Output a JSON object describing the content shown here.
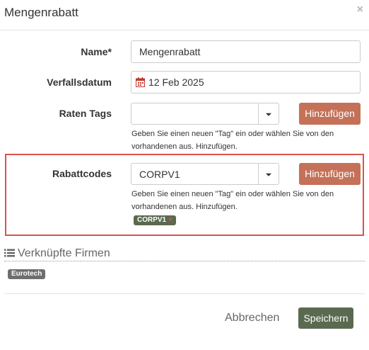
{
  "dialog": {
    "title": "Mengenrabatt",
    "close_glyph": "×"
  },
  "fields": {
    "name": {
      "label": "Name*",
      "value": "Mengenrabatt"
    },
    "expiry": {
      "label": "Verfallsdatum",
      "value": "12 Feb 2025",
      "icon": "calendar-icon"
    },
    "rate_tags": {
      "label": "Raten Tags",
      "value": "",
      "add_label": "Hinzufügen",
      "help_line1": "Geben Sie einen neuen \"Tag\" ein oder wählen Sie von den",
      "help_line2": "vorhandenen aus. Hinzufügen."
    },
    "discount_codes": {
      "label": "Rabattcodes",
      "value": "CORPV1",
      "add_label": "Hinzufügen",
      "help_line1": "Geben Sie einen neuen \"Tag\" ein oder wählen Sie von den",
      "help_line2": "vorhandenen aus. Hinzufügen.",
      "tags": [
        {
          "label": "CORPV1",
          "remove_glyph": "×"
        }
      ]
    }
  },
  "linked_companies": {
    "title": "Verknüpfte Firmen",
    "icon": "list-icon",
    "tags": [
      {
        "label": "Eurotech"
      }
    ]
  },
  "footer": {
    "cancel_label": "Abbrechen",
    "save_label": "Speichern"
  },
  "colors": {
    "add_button": "#c47158",
    "save_button": "#5a6a50",
    "highlight_border": "#d9534f",
    "tag_bg": "#5a6a50"
  }
}
